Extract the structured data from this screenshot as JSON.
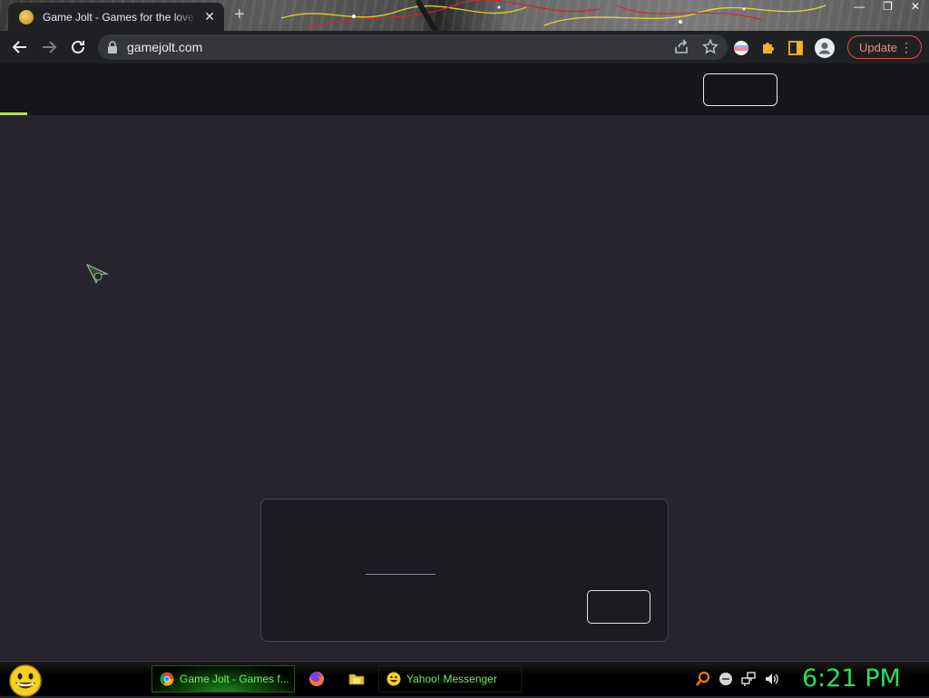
{
  "browser": {
    "tab": {
      "title": "Game Jolt - Games for the love of it"
    },
    "toolbar": {
      "url": "gamejolt.com",
      "update_label": "Update"
    }
  },
  "taskbar": {
    "tasks": [
      {
        "label": "Game Jolt - Games f...",
        "icon": "chrome-icon",
        "active": true
      },
      {
        "label": "Yahoo! Messenger",
        "icon": "yahoo-smiley-icon",
        "active": false
      }
    ],
    "quick_launch": [
      "firefox-icon",
      "folder-icon"
    ],
    "tray_icons": [
      "search-icon",
      "messenger-status-icon",
      "network-icon",
      "volume-icon"
    ],
    "clock": "6:21 PM"
  },
  "colors": {
    "page_bg": "#27242e",
    "header_bg": "#17151b",
    "loader_accent": "#b8e34a",
    "update_red": "#e34b40",
    "clock_green": "#27e05a"
  }
}
